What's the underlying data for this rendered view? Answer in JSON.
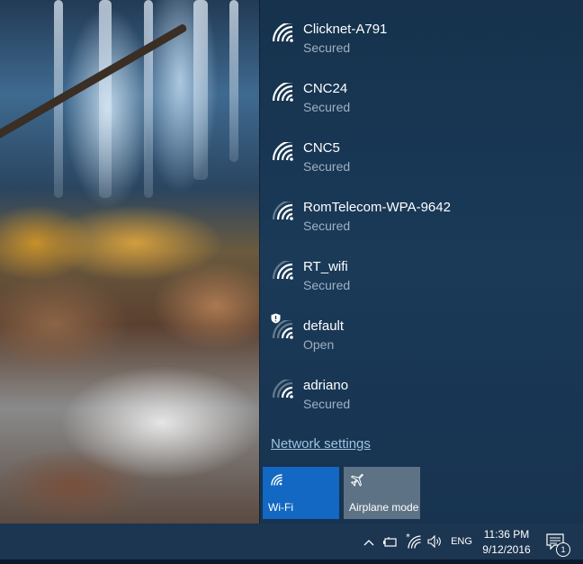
{
  "networks": [
    {
      "name": "Clicknet-A791",
      "status": "Secured",
      "signal": 4,
      "warning": false
    },
    {
      "name": "CNC24",
      "status": "Secured",
      "signal": 4,
      "warning": false
    },
    {
      "name": "CNC5",
      "status": "Secured",
      "signal": 4,
      "warning": false
    },
    {
      "name": "RomTelecom-WPA-9642",
      "status": "Secured",
      "signal": 3,
      "warning": false
    },
    {
      "name": "RT_wifi",
      "status": "Secured",
      "signal": 3,
      "warning": false
    },
    {
      "name": "default",
      "status": "Open",
      "signal": 2,
      "warning": true
    },
    {
      "name": "adriano",
      "status": "Secured",
      "signal": 2,
      "warning": false
    }
  ],
  "network_settings_label": "Network settings",
  "tiles": {
    "wifi": {
      "label": "Wi-Fi",
      "active": true
    },
    "airplane": {
      "label": "Airplane mode",
      "active": false
    }
  },
  "taskbar": {
    "language": "ENG",
    "time": "11:36 PM",
    "date": "9/12/2016",
    "notification_count": "1"
  },
  "colors": {
    "accent": "#1268c2",
    "flyout_bg": "#1a3a58",
    "taskbar_bg": "#1c3550",
    "secondary_text": "#9fb1c3",
    "link": "#9fc3e6"
  }
}
